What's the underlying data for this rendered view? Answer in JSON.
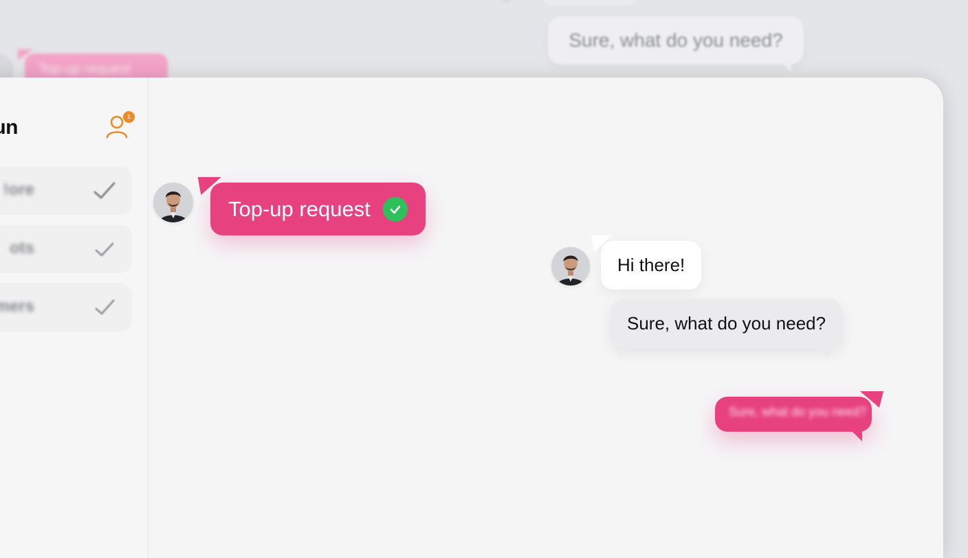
{
  "background": {
    "top_bubble_text": "Sure, what do you need?",
    "pink_bubble_text": "Top-up request"
  },
  "sidebar": {
    "title": "un",
    "contacts_badge": "1",
    "items": [
      {
        "label": "ore!"
      },
      {
        "label": "ots"
      },
      {
        "label": "mers"
      }
    ]
  },
  "chat": {
    "messages": [
      {
        "text": "Top-up request",
        "status": "check-circle-icon"
      },
      {
        "text": "Hi there!"
      },
      {
        "text": "Sure, what do you need?"
      },
      {
        "text": "Sure, what do you need?"
      }
    ]
  },
  "colors": {
    "pink": "#e8417f",
    "green": "#2ec15b",
    "orange": "#f08a24",
    "bubble_gray": "#ebebed",
    "bubble_white": "#ffffff"
  }
}
